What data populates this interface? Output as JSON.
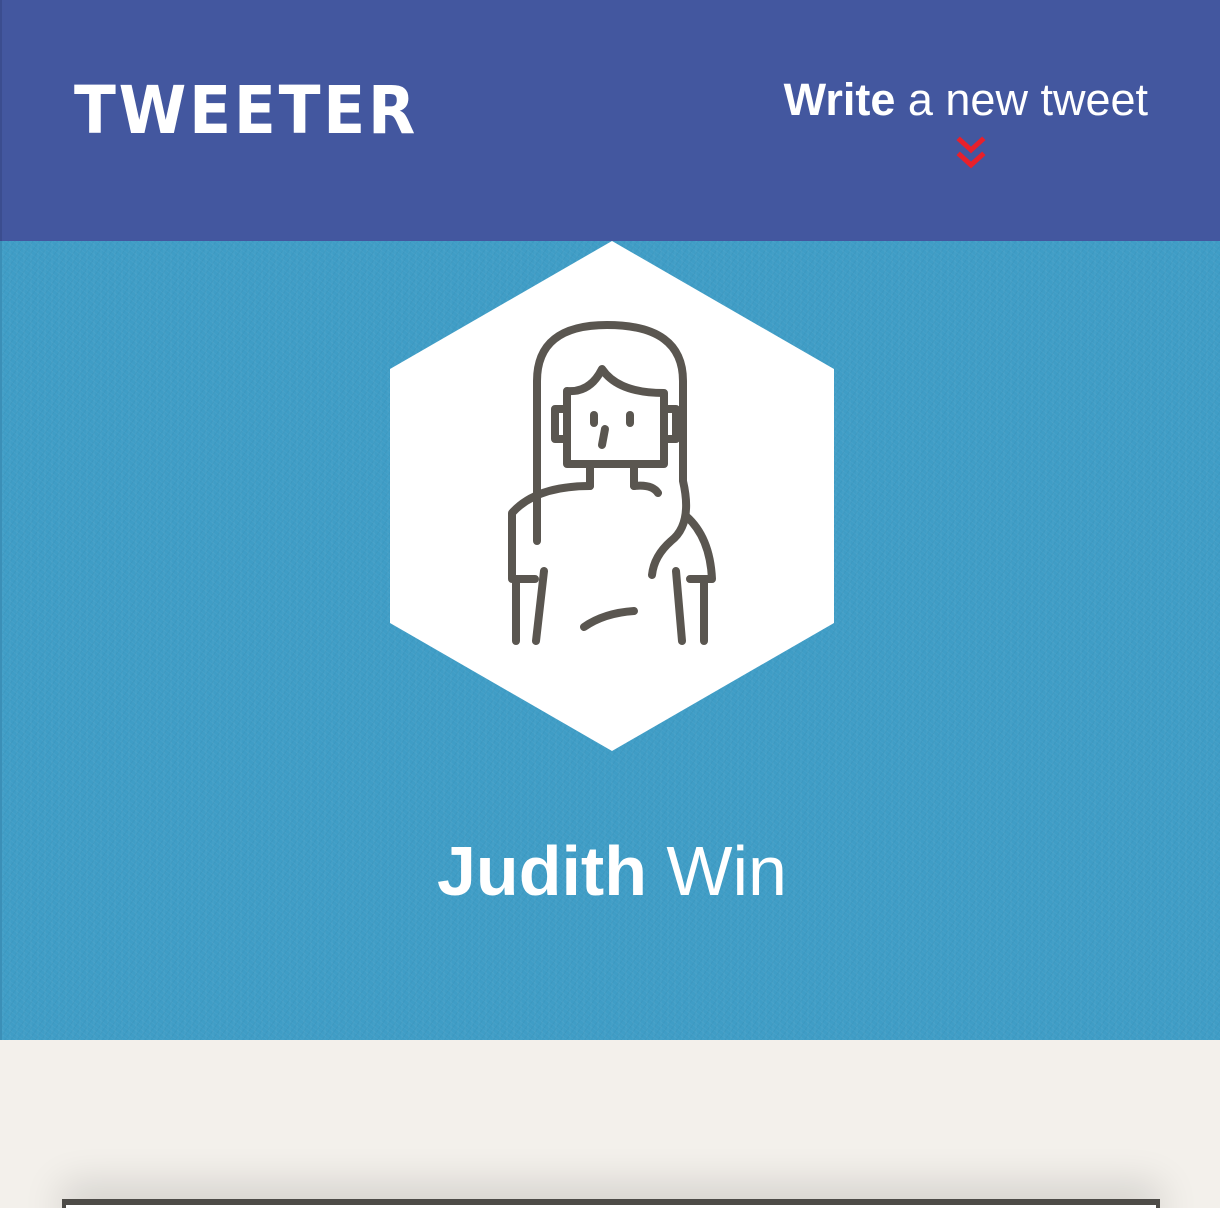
{
  "header": {
    "logo": "TWEETER",
    "compose": {
      "strong": "Write",
      "light": "a new tweet",
      "icon": "double-chevron-down-icon",
      "icon_color": "#e8202b"
    }
  },
  "profile": {
    "avatar_icon": "user-avatar-icon",
    "first_name": "Judith",
    "last_name": "Win"
  },
  "colors": {
    "nav_background": "#43579f",
    "banner_background": "#3f9dc6",
    "page_background": "#f3f0eb",
    "avatar_stroke": "#5a5650"
  }
}
